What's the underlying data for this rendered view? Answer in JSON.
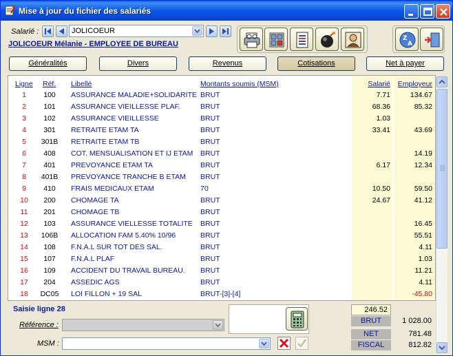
{
  "window": {
    "title": "Mise à jour du fichier des salariés"
  },
  "salarie": {
    "label": "Salarié :",
    "value": "JOLICOEUR",
    "employee_line": "JOLICOEUR Mélanie - EMPLOYEE DE BUREAU"
  },
  "toolbar_icons": [
    "print-icon",
    "calculator-grid-icon",
    "document-list-icon",
    "bomb-icon",
    "person-card-icon"
  ],
  "tabs": [
    {
      "label": "Généralités"
    },
    {
      "label": "Divers"
    },
    {
      "label": "Revenus"
    },
    {
      "label": "Cotisations"
    },
    {
      "label": "Net à payer"
    }
  ],
  "grid": {
    "headers": {
      "ligne": "Ligne",
      "ref": "Réf.",
      "libelle": "Libellé",
      "msm": "Montants soumis (MSM)",
      "salarie": "Salarié",
      "employeur": "Employeur"
    },
    "rows": [
      {
        "ligne": "1",
        "ref": "100",
        "libelle": "ASSURANCE MALADIE+SOLIDARITE",
        "msm": "BRUT",
        "salarie": "7.71",
        "employeur": "134.67"
      },
      {
        "ligne": "2",
        "ref": "101",
        "libelle": "ASSURANCE VIEILLESSE PLAF.",
        "msm": "BRUT",
        "salarie": "68.36",
        "employeur": "85.32"
      },
      {
        "ligne": "3",
        "ref": "102",
        "libelle": "ASSURANCE VIEILLESSE",
        "msm": "BRUT",
        "salarie": "1.03",
        "employeur": ""
      },
      {
        "ligne": "4",
        "ref": "301",
        "libelle": "RETRAITE ETAM TA",
        "msm": "BRUT",
        "salarie": "33.41",
        "employeur": "43.69"
      },
      {
        "ligne": "5",
        "ref": "301B",
        "libelle": "RETRAITE ETAM TB",
        "msm": "BRUT",
        "salarie": "",
        "employeur": ""
      },
      {
        "ligne": "6",
        "ref": "408",
        "libelle": "COT. MENSUALISATION ET IJ ETAM",
        "msm": "BRUT",
        "salarie": "",
        "employeur": "14.19"
      },
      {
        "ligne": "7",
        "ref": "401",
        "libelle": "PREVOYANCE ETAM TA",
        "msm": "BRUT",
        "salarie": "6.17",
        "employeur": "12.34"
      },
      {
        "ligne": "8",
        "ref": "401B",
        "libelle": "PREVOYANCE TRANCHE B ETAM",
        "msm": "BRUT",
        "salarie": "",
        "employeur": ""
      },
      {
        "ligne": "9",
        "ref": "410",
        "libelle": "FRAIS MEDICAUX ETAM",
        "msm": "70",
        "salarie": "10.50",
        "employeur": "59.50"
      },
      {
        "ligne": "10",
        "ref": "200",
        "libelle": "CHOMAGE TA",
        "msm": "BRUT",
        "salarie": "24.67",
        "employeur": "41.12"
      },
      {
        "ligne": "11",
        "ref": "201",
        "libelle": "CHOMAGE TB",
        "msm": "BRUT",
        "salarie": "",
        "employeur": ""
      },
      {
        "ligne": "12",
        "ref": "103",
        "libelle": "ASSURANCE VIELLESSE TOTALITE",
        "msm": "BRUT",
        "salarie": "",
        "employeur": "16.45"
      },
      {
        "ligne": "13",
        "ref": "106B",
        "libelle": "ALLOCATION FAM 5.40% 10/96",
        "msm": "BRUT",
        "salarie": "",
        "employeur": "55.51"
      },
      {
        "ligne": "14",
        "ref": "108",
        "libelle": "F.N.A.L SUR TOT DES SAL.",
        "msm": "BRUT",
        "salarie": "",
        "employeur": "4.11"
      },
      {
        "ligne": "15",
        "ref": "107",
        "libelle": "F.N.A.L  PLAF",
        "msm": "BRUT",
        "salarie": "",
        "employeur": "1.03"
      },
      {
        "ligne": "16",
        "ref": "109",
        "libelle": "ACCIDENT DU TRAVAIL BUREAU.",
        "msm": "BRUT",
        "salarie": "",
        "employeur": "11.21"
      },
      {
        "ligne": "17",
        "ref": "204",
        "libelle": "ASSEDIC AGS",
        "msm": "BRUT",
        "salarie": "",
        "employeur": "4.11"
      },
      {
        "ligne": "18",
        "ref": "DC05",
        "libelle": "LOI FILLON + 19 SAL",
        "msm": "BRUT-[3]-[4]",
        "salarie": "",
        "employeur": "-45.80"
      }
    ]
  },
  "saisie": {
    "title": "Saisie ligne 28",
    "reference_label": "Référence :",
    "msm_label": "MSM :"
  },
  "totals": {
    "salarie_total": "246.52",
    "brut_label": "BRUT",
    "brut_value": "1 028.00",
    "net_label": "NET",
    "net_value": "781.48",
    "fiscal_label": "FISCAL",
    "fiscal_value": "812.82"
  },
  "colors": {
    "title_bar": "#0a5cf0",
    "link_blue": "#0a18a3",
    "line_red": "#d10a0a",
    "amount_bg": "#fcfbd4"
  }
}
